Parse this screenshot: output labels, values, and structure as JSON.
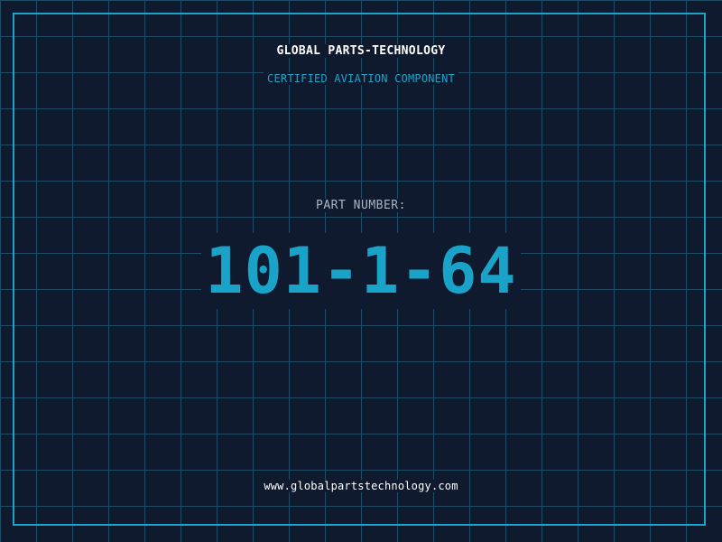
{
  "header": {
    "company": "GLOBAL PARTS-TECHNOLOGY",
    "tagline": "CERTIFIED AVIATION COMPONENT"
  },
  "part": {
    "label": "PART NUMBER:",
    "number": "101-1-64"
  },
  "footer": {
    "website": "www.globalpartstechnology.com"
  },
  "colors": {
    "background": "#101a2e",
    "grid": "#1f4d63",
    "accent": "#1aa3c9",
    "text": "#ffffff",
    "muted": "#a9b4c4"
  }
}
